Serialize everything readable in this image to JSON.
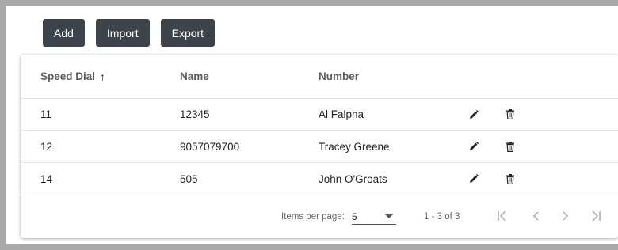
{
  "toolbar": {
    "add_label": "Add",
    "import_label": "Import",
    "export_label": "Export"
  },
  "table": {
    "columns": {
      "speed_dial": "Speed Dial",
      "name": "Name",
      "number": "Number"
    },
    "sort_indicator": "↑",
    "rows": [
      {
        "speed_dial": "11",
        "name": "12345",
        "number": "Al Falpha"
      },
      {
        "speed_dial": "12",
        "name": "9057079700",
        "number": "Tracey Greene"
      },
      {
        "speed_dial": "14",
        "name": "505",
        "number": "John O'Groats"
      }
    ],
    "row_actions": [
      "pencil-icon",
      "trash-icon"
    ]
  },
  "paginator": {
    "items_per_page_label": "Items per page:",
    "items_per_page_value": "5",
    "range_label": "1 - 3 of 3",
    "nav_icons": [
      "first-page-icon",
      "previous-page-icon",
      "next-page-icon",
      "last-page-icon"
    ]
  },
  "colors": {
    "background": "#a9a9a9",
    "button": "#3d434a",
    "disabled_nav": "#b0b0b0"
  }
}
